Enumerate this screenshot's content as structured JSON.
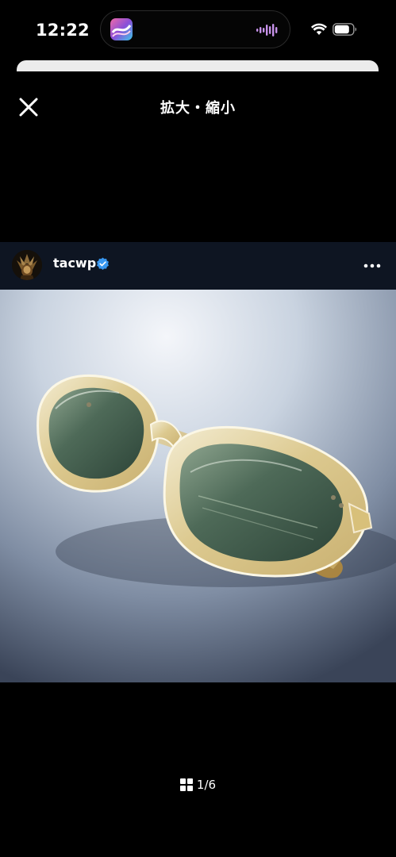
{
  "status_bar": {
    "time": "12:22"
  },
  "header": {
    "title": "拡大・縮小"
  },
  "post": {
    "username": "tacwp"
  },
  "pager": {
    "label": "1/6",
    "current": 1,
    "total": 6
  },
  "icons": {
    "close": "close-icon",
    "verified": "verified-badge-icon",
    "more": "more-options-icon",
    "grid": "grid-icon",
    "wifi": "wifi-icon",
    "battery": "battery-icon",
    "audio_wave": "audio-wave-icon"
  },
  "colors": {
    "background": "#000000",
    "post_header_bg": "#0e1522",
    "verified_blue": "#3897f0",
    "sheet_edge": "#ececec",
    "wave_purple": "#c792ea"
  }
}
